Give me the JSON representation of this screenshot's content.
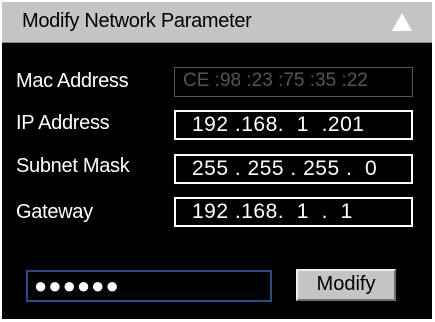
{
  "dialog": {
    "title": "Modify Network Parameter",
    "collapse_icon": "triangle-up-icon"
  },
  "fields": {
    "mac_address": {
      "label": "Mac Address",
      "value": "CE :98 :23 :75 :35 :22",
      "state": "disabled"
    },
    "ip_address": {
      "label": "IP Address",
      "value": "192 .168.  1  .201"
    },
    "subnet_mask": {
      "label": "Subnet Mask",
      "value": "255 . 255 . 255 .  0"
    },
    "gateway": {
      "label": "Gateway",
      "value": "192 .168.  1  .  1"
    }
  },
  "password": {
    "value": "●●●●●●"
  },
  "actions": {
    "modify_label": "Modify"
  },
  "colors": {
    "panel_background": "#000000",
    "titlebar_background": "#c4c4c4",
    "field_text": "#ffffff",
    "disabled_text": "#555555",
    "password_border": "#1f4f8f"
  }
}
